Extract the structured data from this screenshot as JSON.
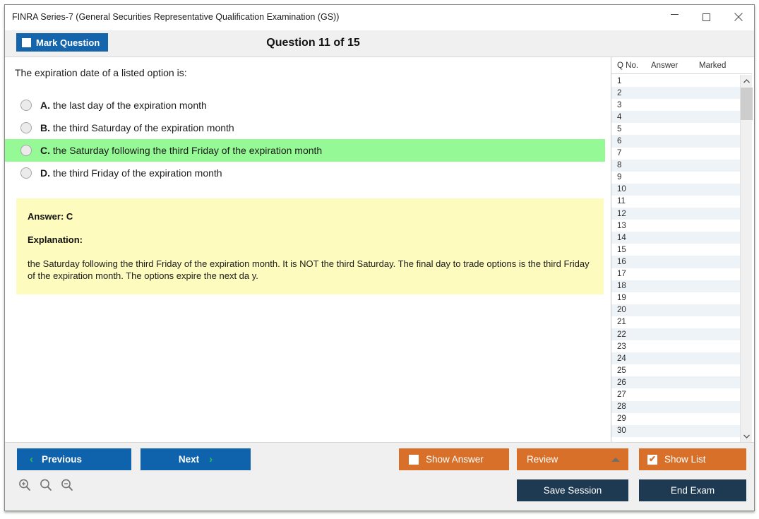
{
  "window": {
    "title": "FINRA Series-7 (General Securities Representative Qualification Examination (GS))",
    "minimize_label": "—",
    "maximize_label": "",
    "close_label": "✕"
  },
  "header": {
    "mark_question_label": "Mark Question",
    "mark_question_checked": false,
    "question_counter": "Question 11 of 15",
    "current_question": 11,
    "total_questions": 15
  },
  "question": {
    "stem": "The expiration date of a listed option is:",
    "options": [
      {
        "letter": "A.",
        "text": "the last day of the expiration month",
        "correct": false
      },
      {
        "letter": "B.",
        "text": "the third Saturday of the expiration month",
        "correct": false
      },
      {
        "letter": "C.",
        "text": "the Saturday following the third Friday of the expiration month",
        "correct": true
      },
      {
        "letter": "D.",
        "text": "the third Friday of the expiration month",
        "correct": false
      }
    ],
    "selected": null
  },
  "answer_panel": {
    "answer_label": "Answer: C",
    "explanation_label": "Explanation:",
    "explanation_text": "the Saturday following the third Friday of the expiration month. It is NOT the third Saturday. The final day to trade options is the third Friday of the expiration month. The options expire the next da y."
  },
  "question_list": {
    "columns": [
      "Q No.",
      "Answer",
      "Marked"
    ],
    "rows": [
      {
        "no": "1",
        "answer": "",
        "marked": ""
      },
      {
        "no": "2",
        "answer": "",
        "marked": ""
      },
      {
        "no": "3",
        "answer": "",
        "marked": ""
      },
      {
        "no": "4",
        "answer": "",
        "marked": ""
      },
      {
        "no": "5",
        "answer": "",
        "marked": ""
      },
      {
        "no": "6",
        "answer": "",
        "marked": ""
      },
      {
        "no": "7",
        "answer": "",
        "marked": ""
      },
      {
        "no": "8",
        "answer": "",
        "marked": ""
      },
      {
        "no": "9",
        "answer": "",
        "marked": ""
      },
      {
        "no": "10",
        "answer": "",
        "marked": ""
      },
      {
        "no": "11",
        "answer": "",
        "marked": ""
      },
      {
        "no": "12",
        "answer": "",
        "marked": ""
      },
      {
        "no": "13",
        "answer": "",
        "marked": ""
      },
      {
        "no": "14",
        "answer": "",
        "marked": ""
      },
      {
        "no": "15",
        "answer": "",
        "marked": ""
      },
      {
        "no": "16",
        "answer": "",
        "marked": ""
      },
      {
        "no": "17",
        "answer": "",
        "marked": ""
      },
      {
        "no": "18",
        "answer": "",
        "marked": ""
      },
      {
        "no": "19",
        "answer": "",
        "marked": ""
      },
      {
        "no": "20",
        "answer": "",
        "marked": ""
      },
      {
        "no": "21",
        "answer": "",
        "marked": ""
      },
      {
        "no": "22",
        "answer": "",
        "marked": ""
      },
      {
        "no": "23",
        "answer": "",
        "marked": ""
      },
      {
        "no": "24",
        "answer": "",
        "marked": ""
      },
      {
        "no": "25",
        "answer": "",
        "marked": ""
      },
      {
        "no": "26",
        "answer": "",
        "marked": ""
      },
      {
        "no": "27",
        "answer": "",
        "marked": ""
      },
      {
        "no": "28",
        "answer": "",
        "marked": ""
      },
      {
        "no": "29",
        "answer": "",
        "marked": ""
      },
      {
        "no": "30",
        "answer": "",
        "marked": ""
      }
    ],
    "scroll_up_label": "˄",
    "scroll_down_label": "˅"
  },
  "footer": {
    "previous_label": "Previous",
    "next_label": "Next",
    "show_answer_label": "Show Answer",
    "show_answer_checked": false,
    "review_label": "Review",
    "show_list_label": "Show List",
    "show_list_checked": true,
    "show_list_check_glyph": "✔",
    "save_session_label": "Save Session",
    "end_exam_label": "End Exam",
    "prev_chevron": "‹",
    "next_chevron": "›"
  },
  "colors": {
    "primary_blue": "#0f63ad",
    "accent_orange": "#d9702a",
    "dark_navy": "#1e3a53",
    "correct_green": "#95fa95",
    "answer_yellow": "#fdfbbd",
    "chevron_green": "#24c24a"
  }
}
